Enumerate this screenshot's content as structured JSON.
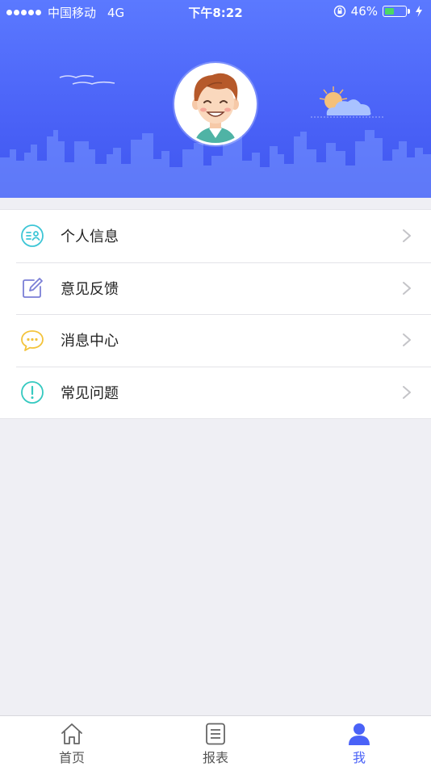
{
  "status_bar": {
    "carrier": "中国移动",
    "network": "4G",
    "time": "下午8:22",
    "battery_percent": "46%",
    "battery_level": 0.46
  },
  "header": {
    "avatar": "user-avatar"
  },
  "menu": {
    "items": [
      {
        "label": "个人信息",
        "icon": "profile-card-icon",
        "color": "#3ec6d6"
      },
      {
        "label": "意见反馈",
        "icon": "edit-icon",
        "color": "#7b7fd6"
      },
      {
        "label": "消息中心",
        "icon": "chat-bubble-icon",
        "color": "#f3c33b"
      },
      {
        "label": "常见问题",
        "icon": "exclamation-circle-icon",
        "color": "#35c9c0"
      }
    ]
  },
  "tabbar": {
    "tabs": [
      {
        "label": "首页",
        "icon": "home-icon",
        "active": false
      },
      {
        "label": "报表",
        "icon": "report-icon",
        "active": false
      },
      {
        "label": "我",
        "icon": "user-icon",
        "active": true
      }
    ]
  },
  "colors": {
    "primary": "#4a62f7",
    "background": "#efeff4"
  }
}
